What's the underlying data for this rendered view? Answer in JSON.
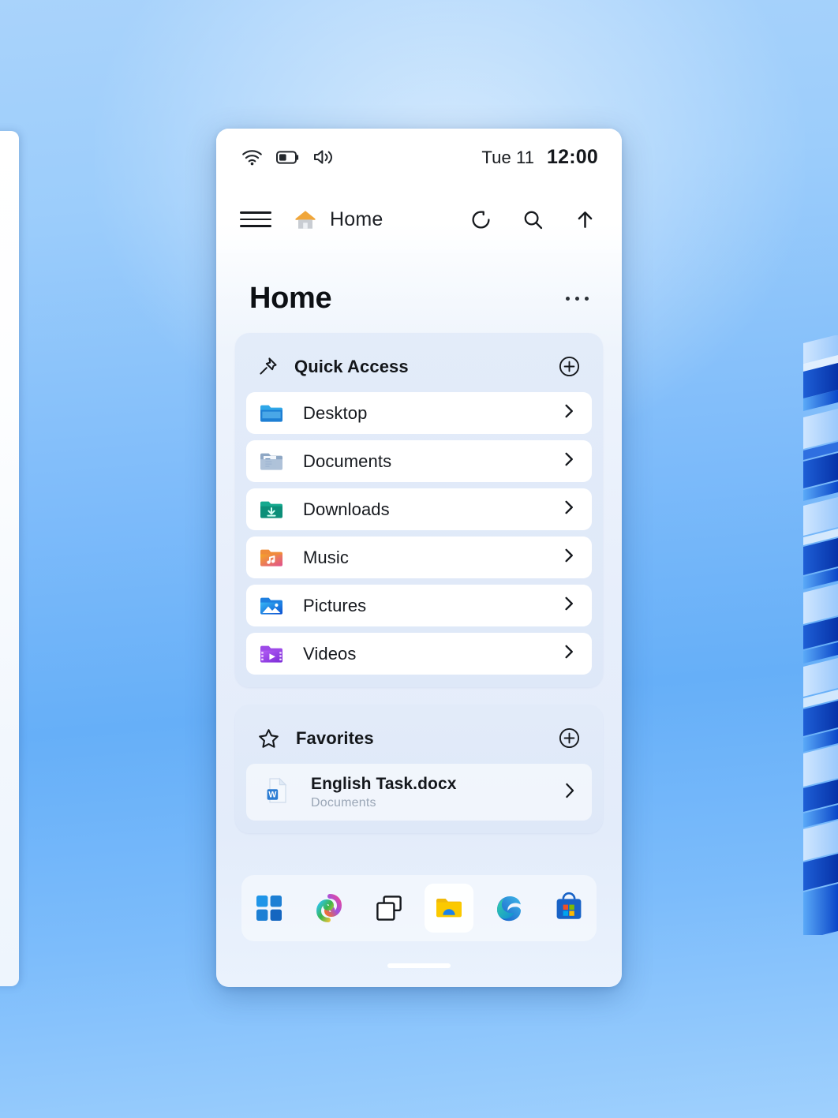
{
  "status_bar": {
    "icons": [
      "wifi-icon",
      "battery-icon",
      "volume-icon"
    ],
    "date": "Tue 11",
    "time": "12:00"
  },
  "nav_bar": {
    "menu_icon": "hamburger-icon",
    "breadcrumb_icon": "home-icon",
    "breadcrumb_label": "Home",
    "actions": [
      {
        "name": "refresh-icon",
        "label": "Refresh"
      },
      {
        "name": "search-icon",
        "label": "Search"
      },
      {
        "name": "up-arrow-icon",
        "label": "Up one level"
      }
    ]
  },
  "page": {
    "title": "Home",
    "more_label": "More options"
  },
  "quick_access": {
    "icon": "pin-icon",
    "title": "Quick Access",
    "add_label": "Add",
    "items": [
      {
        "label": "Desktop",
        "icon": "folder-desktop-icon"
      },
      {
        "label": "Documents",
        "icon": "folder-documents-icon"
      },
      {
        "label": "Downloads",
        "icon": "folder-downloads-icon"
      },
      {
        "label": "Music",
        "icon": "folder-music-icon"
      },
      {
        "label": "Pictures",
        "icon": "folder-pictures-icon"
      },
      {
        "label": "Videos",
        "icon": "folder-videos-icon"
      }
    ]
  },
  "favorites": {
    "icon": "star-icon",
    "title": "Favorites",
    "add_label": "Add",
    "items": [
      {
        "name": "English Task.docx",
        "location": "Documents",
        "icon": "word-document-icon"
      }
    ]
  },
  "taskbar": {
    "buttons": [
      {
        "name": "start-button",
        "label": "Start",
        "active": false
      },
      {
        "name": "copilot-button",
        "label": "Copilot",
        "active": false
      },
      {
        "name": "task-view-button",
        "label": "Task View",
        "active": false
      },
      {
        "name": "file-explorer-button",
        "label": "File Explorer",
        "active": true
      },
      {
        "name": "edge-button",
        "label": "Microsoft Edge",
        "active": false
      },
      {
        "name": "store-button",
        "label": "Microsoft Store",
        "active": false
      }
    ]
  },
  "colors": {
    "accent_blue": "#0f6cbd",
    "desktop_blue": "#7fbcfa",
    "card_bg": "#e2ebf9",
    "row_bg": "#ffffff",
    "text_primary": "#16191e",
    "text_muted": "#9aa6b6",
    "home_icon_orange": "#f0a63a",
    "word_blue": "#2b7cd3"
  }
}
